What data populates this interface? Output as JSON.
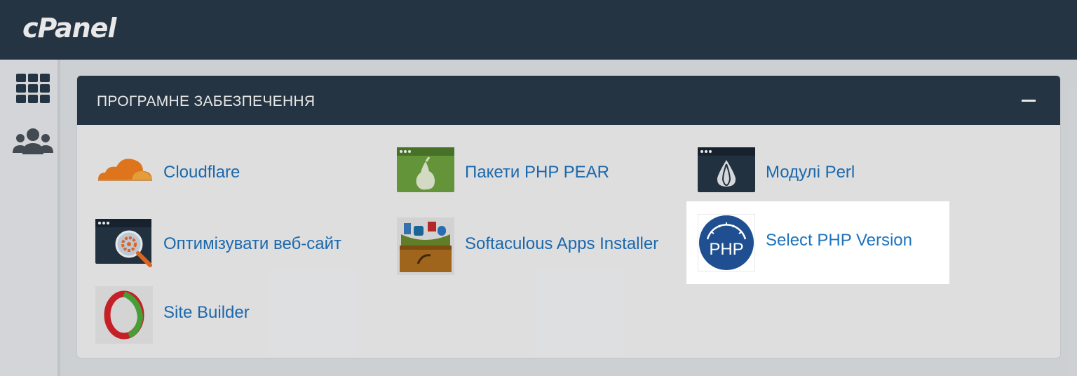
{
  "header": {
    "logo_text": "cPanel"
  },
  "sidebar": {
    "items": [
      {
        "icon": "grid-icon",
        "label": ""
      },
      {
        "icon": "users-icon",
        "label": ""
      }
    ]
  },
  "panel": {
    "title": "ПРОГРАМНЕ ЗАБЕЗПЕЧЕННЯ",
    "collapse_icon": "minus-icon",
    "items": [
      {
        "label": "Cloudflare",
        "icon": "cloudflare-icon"
      },
      {
        "label": "Пакети PHP PEAR",
        "icon": "php-pear-icon"
      },
      {
        "label": "Модулі Perl",
        "icon": "perl-modules-icon"
      },
      {
        "label": "Оптимізувати веб-сайт",
        "icon": "optimize-website-icon"
      },
      {
        "label": "Softaculous Apps Installer",
        "icon": "softaculous-icon"
      },
      {
        "label": "Select PHP Version",
        "icon": "php-version-icon",
        "highlighted": true
      },
      {
        "label": "Site Builder",
        "icon": "site-builder-icon"
      }
    ]
  },
  "colors": {
    "topbar": "#293a4a",
    "link": "#1e73be",
    "background": "#e2e5e8",
    "highlight": "#ffffff"
  }
}
